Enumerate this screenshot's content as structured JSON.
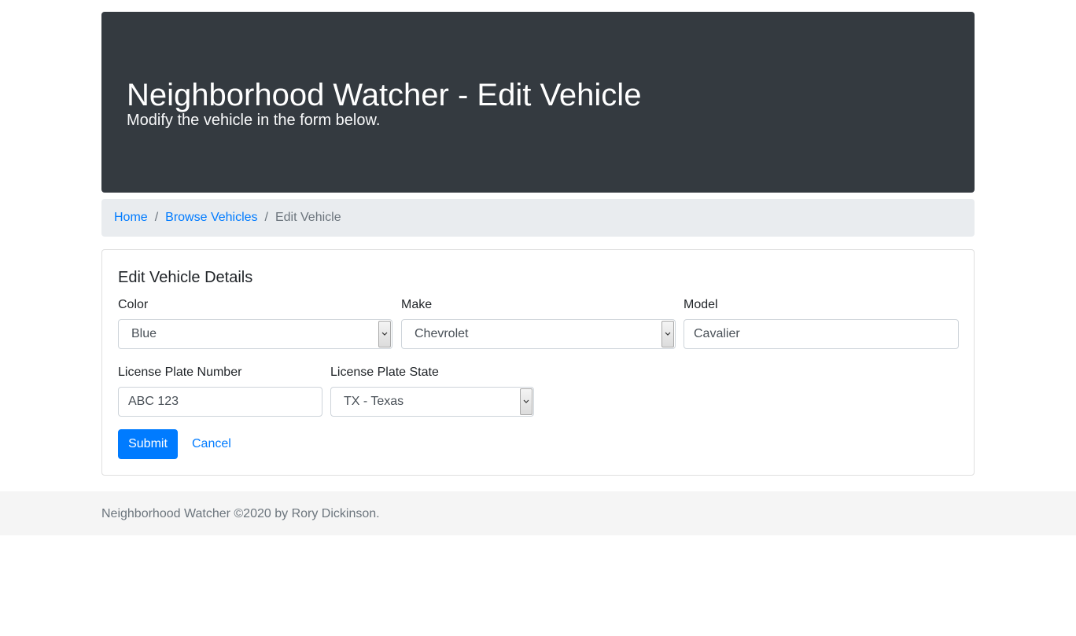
{
  "header": {
    "title": "Neighborhood Watcher - Edit Vehicle",
    "lead": "Modify the vehicle in the form below."
  },
  "breadcrumb": {
    "items": [
      {
        "label": "Home"
      },
      {
        "label": "Browse Vehicles"
      },
      {
        "label": "Edit Vehicle"
      }
    ],
    "separator": "/"
  },
  "form": {
    "title": "Edit Vehicle Details",
    "color": {
      "label": "Color",
      "value": "Blue"
    },
    "make": {
      "label": "Make",
      "value": "Chevrolet"
    },
    "model": {
      "label": "Model",
      "value": "Cavalier"
    },
    "plate_number": {
      "label": "License Plate Number",
      "value": "ABC 123"
    },
    "plate_state": {
      "label": "License Plate State",
      "value": "TX - Texas"
    },
    "submit_label": "Submit",
    "cancel_label": "Cancel"
  },
  "footer": {
    "text": "Neighborhood Watcher ©2020 by Rory Dickinson."
  },
  "colors": {
    "jumbotron_bg": "#343a40",
    "link": "#007bff",
    "primary_button": "#007bff",
    "breadcrumb_bg": "#e9ecef",
    "footer_bg": "#f5f5f5"
  },
  "icons": {
    "select_arrow": "chevron-down-icon"
  }
}
